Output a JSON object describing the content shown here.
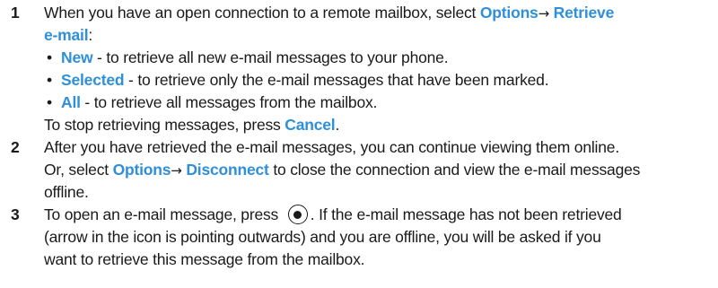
{
  "steps": [
    {
      "num": "1",
      "line1_pre": "When you have an open connection to a remote mailbox, select ",
      "options": "Options",
      "arrow": "→",
      "retrieve": "Retrieve",
      "email": "e-mail",
      "colon": ":",
      "bullets": [
        {
          "dot": "•",
          "term": "New",
          "desc": " - to retrieve all new e-mail messages to your phone."
        },
        {
          "dot": "•",
          "term": "Selected",
          "desc": " - to retrieve only the e-mail messages that have been marked."
        },
        {
          "dot": "•",
          "term": "All",
          "desc": " - to retrieve all messages from the mailbox."
        }
      ],
      "stop_pre": "To stop retrieving messages, press ",
      "cancel": "Cancel",
      "stop_post": "."
    },
    {
      "num": "2",
      "line1": "After you have retrieved the e-mail messages, you can continue viewing them online.",
      "line2_pre": "Or, select ",
      "options": "Options",
      "arrow": "→",
      "disconnect": "Disconnect",
      "line2_post": " to close the connection and view the e-mail messages",
      "line3": "offline."
    },
    {
      "num": "3",
      "line1_pre": "To open an e-mail message, press ",
      "key_icon": "navi-key-select-icon",
      "line1_post": ". If the e-mail message has not been retrieved",
      "line2": "(arrow in the icon is pointing outwards) and you are offline, you will be asked if you",
      "line3": "want to retrieve this message from the mailbox."
    }
  ]
}
